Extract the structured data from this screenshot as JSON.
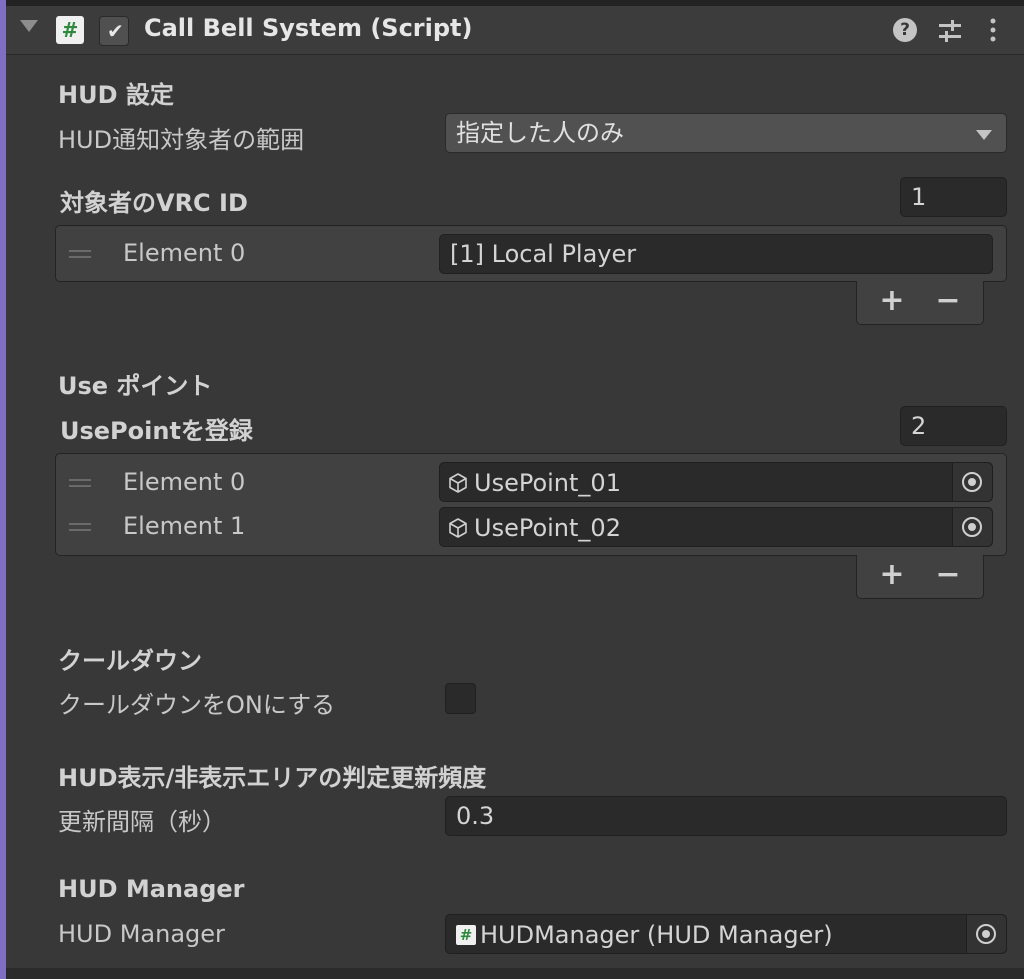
{
  "header": {
    "title": "Call Bell System (Script)",
    "enabled": true,
    "icons": [
      "foldout-arrow-icon",
      "script-icon",
      "help-icon",
      "preset-icon",
      "kebab-menu-icon"
    ]
  },
  "hud_settings": {
    "section_title": "HUD 設定",
    "scope_label": "HUD通知対象者の範囲",
    "scope_value": "指定した人のみ",
    "vrc_id_label": "対象者のVRC ID",
    "vrc_id_count": "1",
    "vrc_id_elements": [
      {
        "label": "Element 0",
        "value": "[1] Local Player"
      }
    ]
  },
  "use_points": {
    "section_title": "Use ポイント",
    "list_label": "UsePointを登録",
    "list_count": "2",
    "elements": [
      {
        "label": "Element 0",
        "value": "UsePoint_01"
      },
      {
        "label": "Element 1",
        "value": "UsePoint_02"
      }
    ]
  },
  "list_controls": {
    "add": "+",
    "remove": "−"
  },
  "cooldown": {
    "section_title": "クールダウン",
    "toggle_label": "クールダウンをONにする",
    "enabled": false
  },
  "hud_area": {
    "section_title": "HUD表示/非表示エリアの判定更新頻度",
    "interval_label": "更新間隔（秒）",
    "interval_value": "0.3"
  },
  "hud_manager": {
    "section_title": "HUD Manager",
    "field_label": "HUD Manager",
    "field_value": "HUDManager (HUD Manager)"
  },
  "colors": {
    "background": "#383838",
    "header": "#3c3c3c",
    "accent_bar": "#7e6fc2",
    "field": "#2a2a2a"
  }
}
